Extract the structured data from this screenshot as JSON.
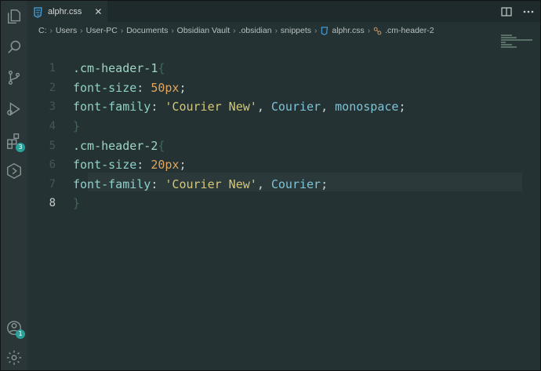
{
  "tab": {
    "label": "alphr.css",
    "close": "✕"
  },
  "breadcrumb": [
    "C:",
    "Users",
    "User-PC",
    "Documents",
    "Obsidian Vault",
    ".obsidian",
    "snippets",
    "alphr.css",
    ".cm-header-2"
  ],
  "activity_bar": {
    "icons": [
      "files-icon",
      "search-icon",
      "source-control-icon",
      "run-debug-icon",
      "extensions-icon",
      "remote-icon"
    ],
    "extensions_badge": "3",
    "accounts_badge": "1"
  },
  "editor": {
    "lines": [
      {
        "number": "1",
        "tokens": [
          {
            "t": ".cm-header-1",
            "c": "c-sel"
          },
          {
            "t": "{",
            "c": "c-brace"
          }
        ]
      },
      {
        "number": "2",
        "tokens": [
          {
            "t": "font-size",
            "c": "c-prop"
          },
          {
            "t": ": ",
            "c": "c-punc"
          },
          {
            "t": "50px",
            "c": "c-num"
          },
          {
            "t": ";",
            "c": "c-punc"
          }
        ]
      },
      {
        "number": "3",
        "tokens": [
          {
            "t": "font-family",
            "c": "c-prop"
          },
          {
            "t": ": ",
            "c": "c-punc"
          },
          {
            "t": "'Courier New'",
            "c": "c-str"
          },
          {
            "t": ", ",
            "c": "c-punc"
          },
          {
            "t": "Courier",
            "c": "c-val"
          },
          {
            "t": ", ",
            "c": "c-punc"
          },
          {
            "t": "monospace",
            "c": "c-val"
          },
          {
            "t": ";",
            "c": "c-punc"
          }
        ]
      },
      {
        "number": "4",
        "tokens": [
          {
            "t": "}",
            "c": "c-brace"
          }
        ]
      },
      {
        "number": "5",
        "tokens": [
          {
            "t": ".cm-header-2",
            "c": "c-sel"
          },
          {
            "t": "{",
            "c": "c-brace"
          }
        ]
      },
      {
        "number": "6",
        "tokens": [
          {
            "t": "font-size",
            "c": "c-prop"
          },
          {
            "t": ": ",
            "c": "c-punc"
          },
          {
            "t": "20px",
            "c": "c-num"
          },
          {
            "t": ";",
            "c": "c-punc"
          }
        ]
      },
      {
        "number": "7",
        "tokens": [
          {
            "t": "font-family",
            "c": "c-prop"
          },
          {
            "t": ": ",
            "c": "c-punc"
          },
          {
            "t": "'Courier New'",
            "c": "c-str"
          },
          {
            "t": ", ",
            "c": "c-punc"
          },
          {
            "t": "Courier",
            "c": "c-val"
          },
          {
            "t": ";",
            "c": "c-punc"
          }
        ]
      },
      {
        "number": "8",
        "tokens": [
          {
            "t": "}",
            "c": "c-brace"
          }
        ]
      }
    ],
    "active_line": "8"
  },
  "colors": {
    "background": "#253234",
    "accent_badge": "#2aa198",
    "css_icon": "#4aa3df"
  }
}
